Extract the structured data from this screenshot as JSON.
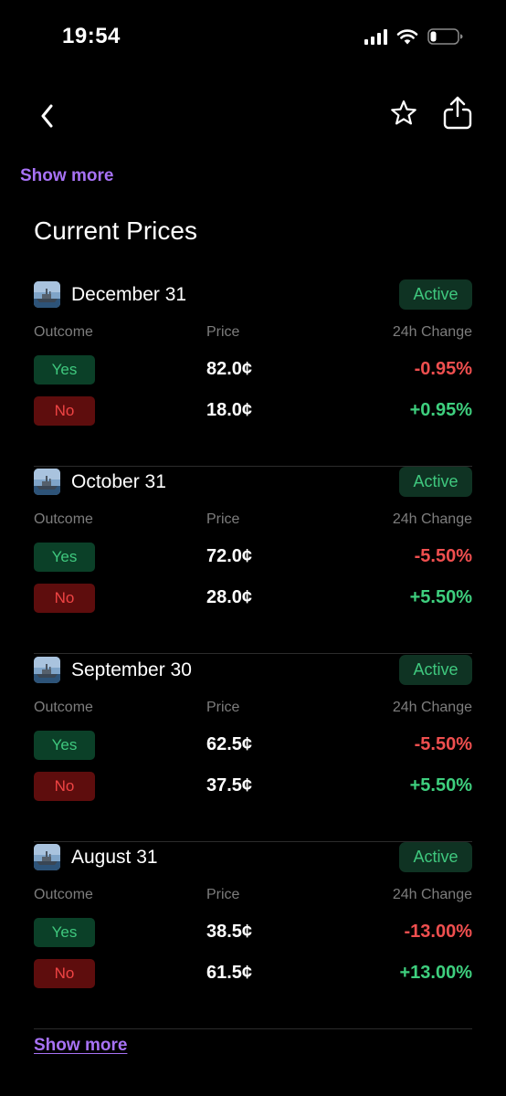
{
  "status_bar": {
    "time": "19:54"
  },
  "nav": {
    "back_icon": "chevron-left-icon",
    "favorite_icon": "star-icon",
    "share_icon": "share-icon"
  },
  "show_more_top": "Show more",
  "section_title": "Current Prices",
  "columns": {
    "outcome": "Outcome",
    "price": "Price",
    "change": "24h Change"
  },
  "markets": [
    {
      "date": "December 31",
      "status": "Active",
      "yes": {
        "label": "Yes",
        "price": "82.0¢",
        "change": "-0.95%"
      },
      "no": {
        "label": "No",
        "price": "18.0¢",
        "change": "+0.95%"
      }
    },
    {
      "date": "October 31",
      "status": "Active",
      "yes": {
        "label": "Yes",
        "price": "72.0¢",
        "change": "-5.50%"
      },
      "no": {
        "label": "No",
        "price": "28.0¢",
        "change": "+5.50%"
      }
    },
    {
      "date": "September 30",
      "status": "Active",
      "yes": {
        "label": "Yes",
        "price": "62.5¢",
        "change": "-5.50%"
      },
      "no": {
        "label": "No",
        "price": "37.5¢",
        "change": "+5.50%"
      }
    },
    {
      "date": "August 31",
      "status": "Active",
      "yes": {
        "label": "Yes",
        "price": "38.5¢",
        "change": "-13.00%"
      },
      "no": {
        "label": "No",
        "price": "61.5¢",
        "change": "+13.00%"
      }
    }
  ],
  "show_more_bottom": "Show more",
  "colors": {
    "accent": "#a772f5",
    "positive": "#3ecf7e",
    "negative": "#ef4f4f",
    "badge_bg": "#0f3323",
    "yes_bg": "#0b4028",
    "no_bg": "#5e0d0d"
  }
}
